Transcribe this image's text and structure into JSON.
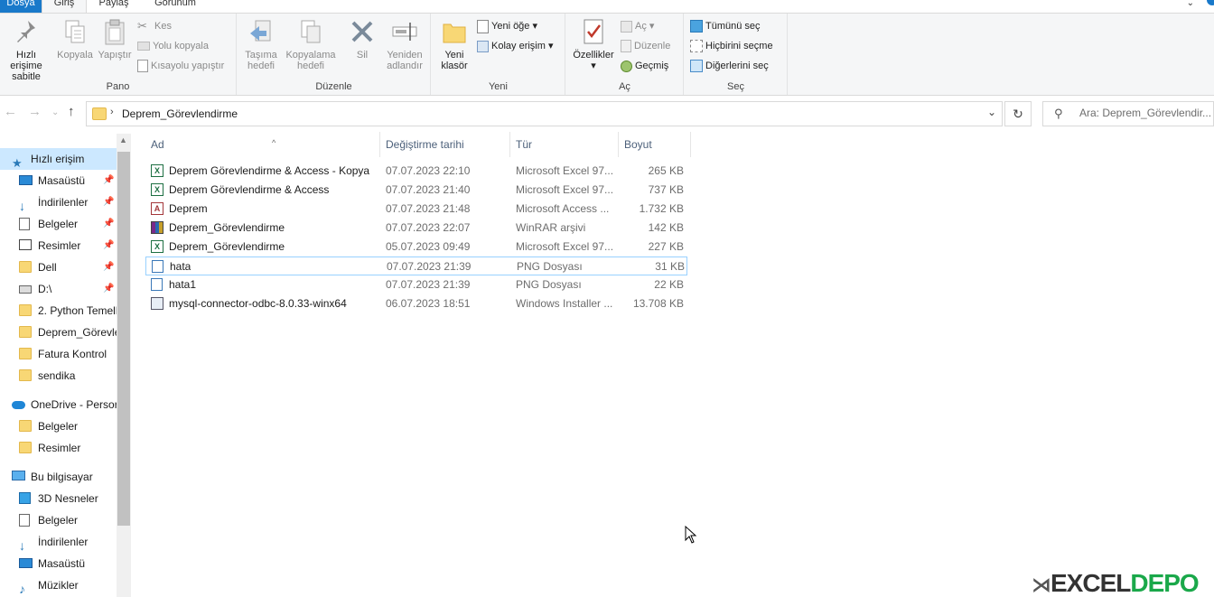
{
  "tabs": {
    "file": "Dosya",
    "home": "Giriş",
    "share": "Paylaş",
    "view": "Görünüm"
  },
  "ribbon": {
    "pano": {
      "label": "Pano",
      "pin_quick": "Hızlı erişime sabitle",
      "copy": "Kopyala",
      "paste": "Yapıştır",
      "cut": "Kes",
      "copy_path": "Yolu kopyala",
      "paste_shortcut": "Kısayolu yapıştır"
    },
    "duzenle": {
      "label": "Düzenle",
      "move_to": "Taşıma hedefi",
      "copy_to": "Kopyalama hedefi",
      "delete": "Sil",
      "rename": "Yeniden adlandır"
    },
    "yeni": {
      "label": "Yeni",
      "new_folder": "Yeni klasör",
      "new_item": "Yeni öğe",
      "easy_access": "Kolay erişim"
    },
    "ac": {
      "label": "Aç",
      "properties": "Özellikler",
      "open": "Aç",
      "edit": "Düzenle",
      "history": "Geçmiş"
    },
    "sec": {
      "label": "Seç",
      "select_all": "Tümünü seç",
      "select_none": "Hiçbirini seçme",
      "invert": "Diğerlerini seç"
    }
  },
  "address": {
    "path": "Deprem_Görevlendirme",
    "search_placeholder": "Ara: Deprem_Görevlendir..."
  },
  "navpane": {
    "items": [
      {
        "label": "Hızlı erişim",
        "icon": "star-icon",
        "pinned": false
      },
      {
        "label": "Masaüstü",
        "icon": "desktop-icon",
        "pinned": true
      },
      {
        "label": "İndirilenler",
        "icon": "download-icon",
        "pinned": true
      },
      {
        "label": "Belgeler",
        "icon": "documents-icon",
        "pinned": true
      },
      {
        "label": "Resimler",
        "icon": "pictures-icon",
        "pinned": true
      },
      {
        "label": "Dell",
        "icon": "folder-icon",
        "pinned": true
      },
      {
        "label": "D:\\",
        "icon": "drive-icon",
        "pinned": true
      },
      {
        "label": "2. Python Temell",
        "icon": "folder-icon",
        "pinned": false
      },
      {
        "label": "Deprem_Görevle",
        "icon": "folder-icon",
        "pinned": false
      },
      {
        "label": "Fatura Kontrol",
        "icon": "folder-icon",
        "pinned": false
      },
      {
        "label": "sendika",
        "icon": "folder-icon",
        "pinned": false
      },
      {
        "label": "OneDrive - Persor",
        "icon": "cloud-icon",
        "pinned": false
      },
      {
        "label": "Belgeler",
        "icon": "folder-icon",
        "pinned": false
      },
      {
        "label": "Resimler",
        "icon": "folder-icon",
        "pinned": false
      },
      {
        "label": "Bu bilgisayar",
        "icon": "computer-icon",
        "pinned": false
      },
      {
        "label": "3D Nesneler",
        "icon": "cube-icon",
        "pinned": false
      },
      {
        "label": "Belgeler",
        "icon": "documents-icon",
        "pinned": false
      },
      {
        "label": "İndirilenler",
        "icon": "download-icon",
        "pinned": false
      },
      {
        "label": "Masaüstü",
        "icon": "desktop-icon",
        "pinned": false
      },
      {
        "label": "Müzikler",
        "icon": "music-icon",
        "pinned": false
      }
    ]
  },
  "columns": {
    "name": "Ad",
    "date": "Değiştirme tarihi",
    "type": "Tür",
    "size": "Boyut"
  },
  "files": [
    {
      "name": "Deprem Görevlendirme & Access - Kopya",
      "date": "07.07.2023 22:10",
      "type": "Microsoft Excel 97...",
      "size": "265 KB",
      "icon": "excel-icon"
    },
    {
      "name": "Deprem Görevlendirme & Access",
      "date": "07.07.2023 21:40",
      "type": "Microsoft Excel 97...",
      "size": "737 KB",
      "icon": "excel-icon"
    },
    {
      "name": "Deprem",
      "date": "07.07.2023 21:48",
      "type": "Microsoft Access ...",
      "size": "1.732 KB",
      "icon": "access-icon"
    },
    {
      "name": "Deprem_Görevlendirme",
      "date": "07.07.2023 22:07",
      "type": "WinRAR arşivi",
      "size": "142 KB",
      "icon": "winrar-icon"
    },
    {
      "name": "Deprem_Görevlendirme",
      "date": "05.07.2023 09:49",
      "type": "Microsoft Excel 97...",
      "size": "227 KB",
      "icon": "excel-icon"
    },
    {
      "name": "hata",
      "date": "07.07.2023 21:39",
      "type": "PNG Dosyası",
      "size": "31 KB",
      "icon": "image-icon"
    },
    {
      "name": "hata1",
      "date": "07.07.2023 21:39",
      "type": "PNG Dosyası",
      "size": "22 KB",
      "icon": "image-icon"
    },
    {
      "name": "mysql-connector-odbc-8.0.33-winx64",
      "date": "06.07.2023 18:51",
      "type": "Windows Installer ...",
      "size": "13.708 KB",
      "icon": "installer-icon"
    }
  ],
  "watermark": {
    "part1": "EXCEL",
    "part2": "DEPO"
  }
}
